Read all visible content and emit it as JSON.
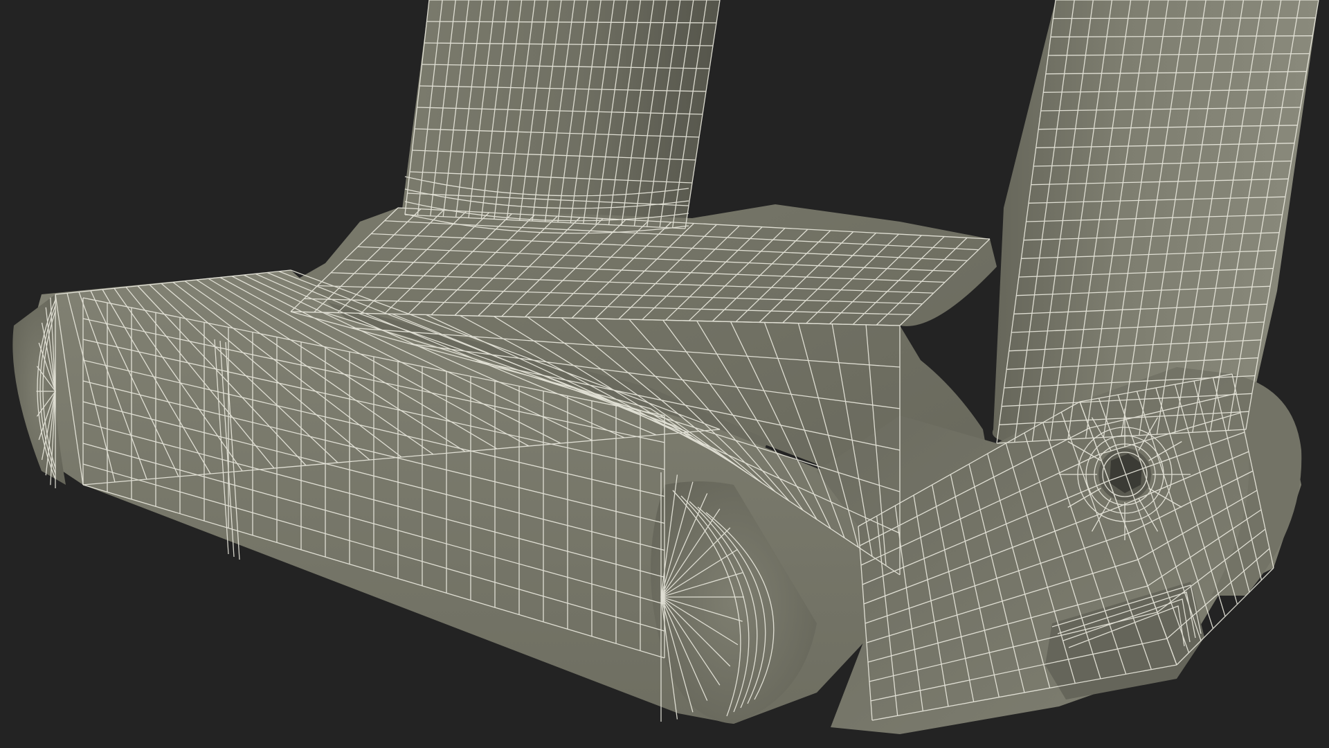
{
  "scene": {
    "background_color": "#232323",
    "surface_color": "#767668",
    "surface_shadow_color": "#55554b",
    "surface_highlight_color": "#8a8a7c",
    "wireframe_color": "#ecebe0",
    "description_icon": "wireframe-mesh-render"
  }
}
